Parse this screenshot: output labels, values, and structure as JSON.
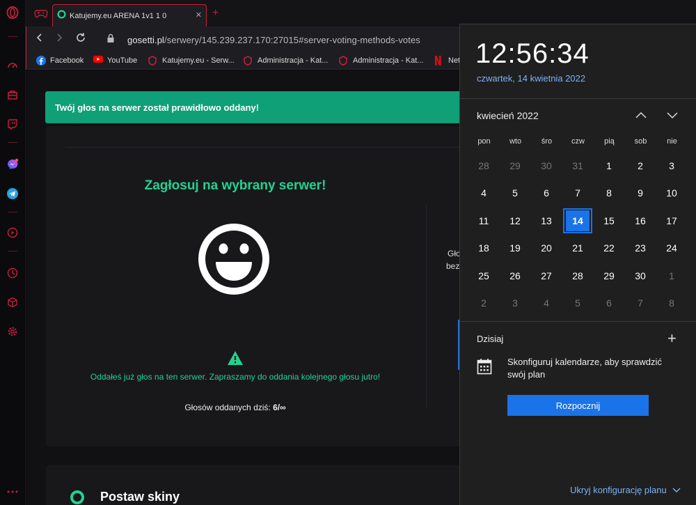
{
  "browser": {
    "tab": {
      "title": "Katujemy.eu ARENA 1v1 1 0",
      "close": "✕"
    },
    "newtab": "+",
    "url": {
      "host": "gosetti.pl",
      "path": "/serwery/145.239.237.170:27015#server-voting-methods-votes"
    },
    "bookmarks": [
      {
        "label": "Facebook"
      },
      {
        "label": "YouTube"
      },
      {
        "label": "Katujemy.eu - Serw..."
      },
      {
        "label": "Administracja - Kat..."
      },
      {
        "label": "Administracja - Kat..."
      },
      {
        "label": "Net"
      }
    ],
    "accent": "#c41e3a"
  },
  "page": {
    "toast": "Twój głos na serwer został prawidłowo oddany!",
    "vote_title": "Zagłosuj na wybrany serwer!",
    "already_voted": "Oddałeś już głos na ten serwer. Zapraszamy do oddania kolejnego głosu jutro!",
    "count_label": "Głosów oddanych dziś:",
    "count_value": "6/∞",
    "cut_text_1": "Gło",
    "cut_text_2": "bez",
    "skins_title": "Postaw skiny",
    "accent": "#22d38f"
  },
  "flyout": {
    "time": "12:56:34",
    "date": "czwartek, 14 kwietnia 2022",
    "month": "kwiecień 2022",
    "weekdays": [
      "pon",
      "wto",
      "śro",
      "czw",
      "pią",
      "sob",
      "nie"
    ],
    "weeks": [
      [
        "28",
        "29",
        "30",
        "31",
        "1",
        "2",
        "3"
      ],
      [
        "4",
        "5",
        "6",
        "7",
        "8",
        "9",
        "10"
      ],
      [
        "11",
        "12",
        "13",
        "14",
        "15",
        "16",
        "17"
      ],
      [
        "18",
        "19",
        "20",
        "21",
        "22",
        "23",
        "24"
      ],
      [
        "25",
        "26",
        "27",
        "28",
        "29",
        "30",
        "1"
      ],
      [
        "2",
        "3",
        "4",
        "5",
        "6",
        "7",
        "8"
      ]
    ],
    "today": "14",
    "today_label": "Dzisiaj",
    "add": "+",
    "config_text": "Skonfiguruj kalendarze, aby sprawdzić swój plan",
    "start_button": "Rozpocznij",
    "hide_link": "Ukryj konfigurację planu",
    "accent": "#1a73e8"
  }
}
